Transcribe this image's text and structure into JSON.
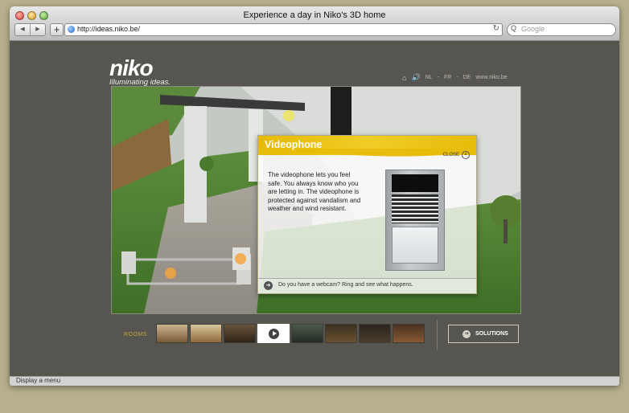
{
  "browser": {
    "window_title": "Experience a day in Niko's 3D home",
    "back_glyph": "◀",
    "forward_glyph": "▶",
    "new_tab_glyph": "+",
    "url": "http://ideas.niko.be/",
    "reload_glyph": "↻",
    "search_glyph": "Q",
    "search_placeholder": "Google",
    "status_text": "Display a menu"
  },
  "site": {
    "brand": "niko",
    "tagline": "Illuminating ideas.",
    "nav": {
      "home_icon": "home-icon",
      "sound_icon": "speaker-icon",
      "lang_nl": "NL",
      "lang_fr": "FR",
      "lang_de": "DE",
      "separator": "-",
      "website": "www.niko.be"
    }
  },
  "popup": {
    "title": "Videophone",
    "close_label": "CLOSE",
    "close_glyph": "×",
    "body": "The videophone lets you feel safe. You always know who you are letting in. The videophone is protected against vandalism and weather and wind resistant.",
    "footer_glyph": "➔",
    "footer_text": "Do you have a webcam? Ring and see what happens."
  },
  "rooms": {
    "label": "ROOMS",
    "count": 8,
    "active_index": 3
  },
  "solutions": {
    "glyph": "➔",
    "label": "SOLUTIONS"
  },
  "colors": {
    "accent_yellow": "#e8bc0a",
    "page_bg": "#56554f",
    "rooms_label": "#c9a83a"
  }
}
